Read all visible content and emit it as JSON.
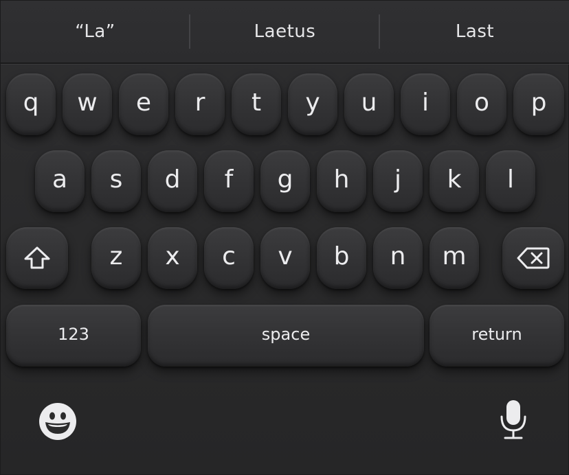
{
  "suggestions": [
    "“La”",
    "Laetus",
    "Last"
  ],
  "rows": [
    [
      "q",
      "w",
      "e",
      "r",
      "t",
      "y",
      "u",
      "i",
      "o",
      "p"
    ],
    [
      "a",
      "s",
      "d",
      "f",
      "g",
      "h",
      "j",
      "k",
      "l"
    ],
    [
      "z",
      "x",
      "c",
      "v",
      "b",
      "n",
      "m"
    ]
  ],
  "keys": {
    "shift_icon": "shift-arrow-icon",
    "delete_icon": "backspace-icon",
    "numbers_label": "123",
    "space_label": "space",
    "return_label": "return"
  },
  "bottom_bar": {
    "emoji_icon": "smiley-face-icon",
    "dictation_icon": "microphone-icon"
  },
  "colors": {
    "background": "#2b2b2c",
    "key": "#343436",
    "text": "#ececee"
  }
}
